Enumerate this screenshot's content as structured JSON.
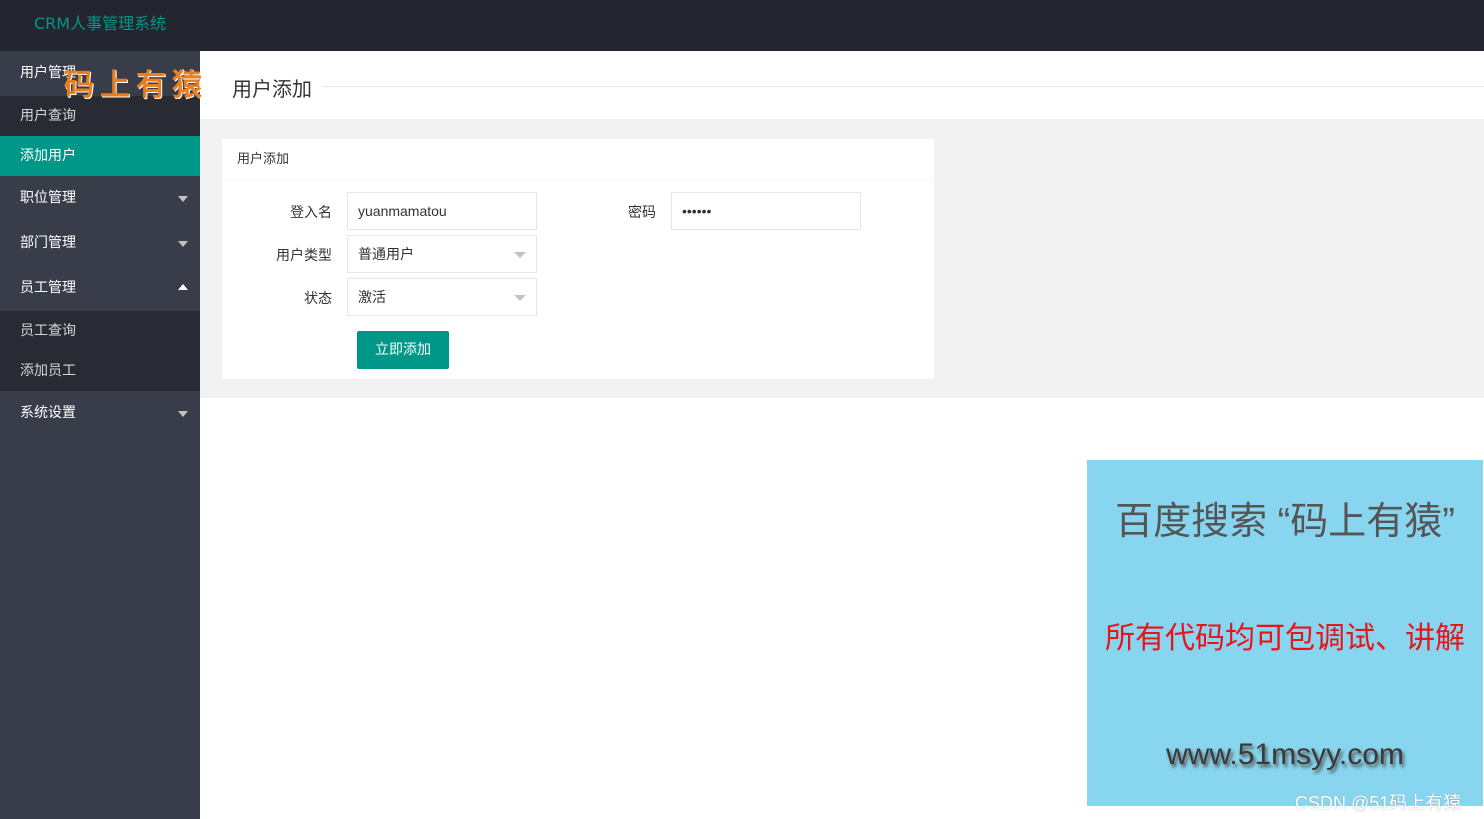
{
  "app": {
    "logo": "CRM人事管理系统"
  },
  "sidebar": {
    "groups": [
      {
        "label": "用户管理",
        "items": [
          {
            "label": "用户查询"
          },
          {
            "label": "添加用户"
          }
        ]
      },
      {
        "label": "职位管理"
      },
      {
        "label": "部门管理"
      },
      {
        "label": "员工管理",
        "items": [
          {
            "label": "员工查询"
          },
          {
            "label": "添加员工"
          }
        ]
      },
      {
        "label": "系统设置"
      }
    ]
  },
  "watermark": {
    "text": "码上有猿"
  },
  "page": {
    "title": "用户添加"
  },
  "form": {
    "header": "用户添加",
    "login_label": "登入名",
    "login_value": "yuanmamatou",
    "password_label": "密码",
    "password_value": "••••••",
    "type_label": "用户类型",
    "type_value": "普通用户",
    "status_label": "状态",
    "status_value": "激活",
    "submit": "立即添加"
  },
  "ad": {
    "line1": "百度搜索 “码上有猿”",
    "line2": "所有代码均可包调试、讲解",
    "line3": "www.51msyy.com"
  },
  "footer": {
    "csdn": "CSDN @51码上有猿"
  },
  "colors": {
    "accent": "#009688",
    "topbar": "#23262e",
    "sidebar": "#393d49",
    "submenu": "#282b33",
    "ad_bg": "#87d5ee",
    "ad_red": "#e8141b"
  }
}
